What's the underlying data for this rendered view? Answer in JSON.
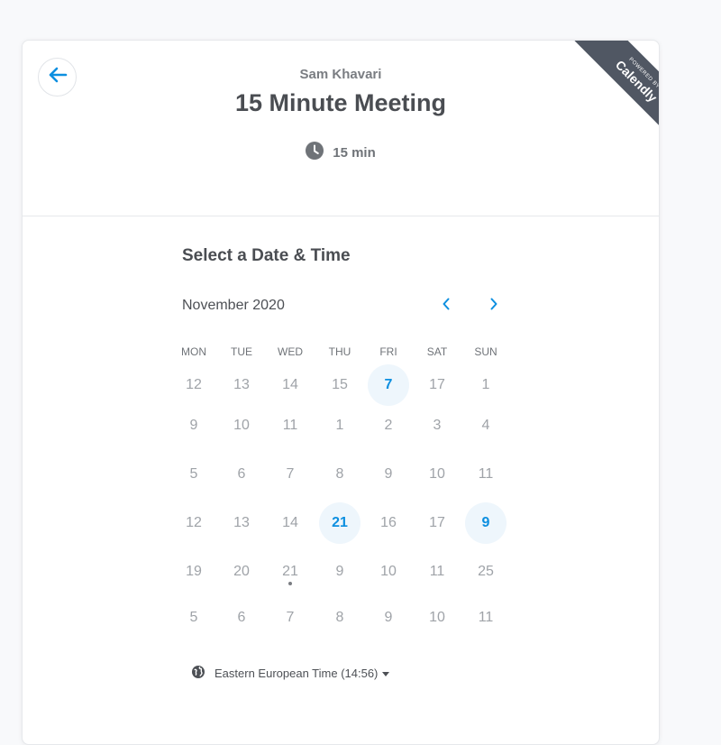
{
  "event": {
    "host": "Sam Khavari",
    "title": "15 Minute Meeting",
    "duration": "15 min"
  },
  "branding": {
    "powered_by": "POWERED BY",
    "brand": "Calendly"
  },
  "picker": {
    "title": "Select a Date & Time",
    "month": "November 2020",
    "weekdays": [
      "MON",
      "TUE",
      "WED",
      "THU",
      "FRI",
      "SAT",
      "SUN"
    ],
    "weeks": [
      [
        "12",
        "13",
        "14",
        "15",
        "7",
        "17",
        "1"
      ],
      [
        "9",
        "10",
        "11",
        "1",
        "2",
        "3",
        "4"
      ],
      [
        "5",
        "6",
        "7",
        "8",
        "9",
        "10",
        "11"
      ],
      [
        "12",
        "13",
        "14",
        "21",
        "16",
        "17",
        "9"
      ],
      [
        "19",
        "20",
        "21",
        "9",
        "10",
        "11",
        "25"
      ],
      [
        "5",
        "6",
        "7",
        "8",
        "9",
        "10",
        "11"
      ]
    ],
    "available": [
      "0-4",
      "3-3",
      "3-6"
    ],
    "today": "4-2"
  },
  "timezone": {
    "label": "Eastern European Time (14:56)"
  },
  "colors": {
    "accent": "#0d8fe0",
    "available_bg": "#eef6fc",
    "ribbon": "#505763"
  },
  "icons": {
    "back": "arrow-left-icon",
    "duration": "clock-icon",
    "prev": "chevron-left-icon",
    "next": "chevron-right-icon",
    "timezone": "globe-icon",
    "dropdown": "caret-down-icon"
  }
}
